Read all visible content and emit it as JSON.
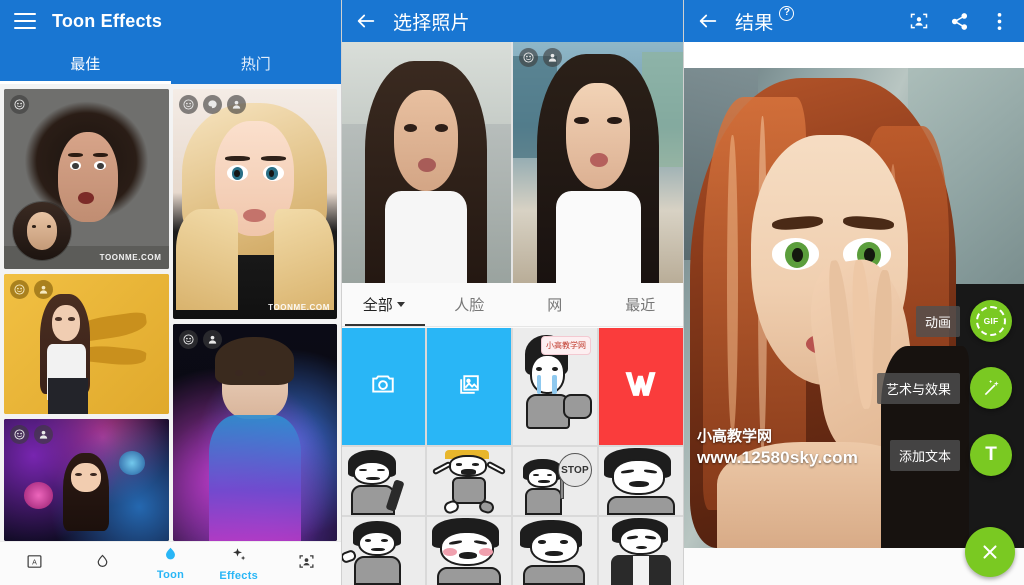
{
  "panel1": {
    "appbar": {
      "menu_icon": "hamburger-icon",
      "title": "Toon Effects"
    },
    "tabs": [
      {
        "label": "最佳",
        "active": true
      },
      {
        "label": "热门",
        "active": false
      }
    ],
    "cards": [
      {
        "id": "card-toonme-3d",
        "watermark": "TOONME.COM",
        "badges": [
          "smiley-icon",
          "person-icon"
        ]
      },
      {
        "id": "card-blonde-toon",
        "watermark": "TOONME.COM",
        "badges": [
          "smiley-icon",
          "paint-icon",
          "person-icon"
        ]
      },
      {
        "id": "card-yellow-portrait",
        "watermark": "",
        "badges": [
          "smiley-icon",
          "person-icon"
        ]
      },
      {
        "id": "card-purple-dress",
        "watermark": "",
        "badges": [
          "smiley-icon",
          "person-icon"
        ]
      },
      {
        "id": "card-neon-floral",
        "watermark": "",
        "badges": [
          "smiley-icon",
          "person-icon"
        ]
      }
    ],
    "bottom_nav": [
      {
        "icon": "frame-icon",
        "label": "",
        "active": false
      },
      {
        "icon": "droplet-outline-icon",
        "label": "",
        "active": false
      },
      {
        "icon": "flame-icon",
        "label": "Toon",
        "active": true
      },
      {
        "icon": "sparkle-icon",
        "label": "Effects",
        "active": true
      },
      {
        "icon": "portrait-icon",
        "label": "",
        "active": false
      }
    ]
  },
  "panel2": {
    "appbar": {
      "back_icon": "arrow-left-icon",
      "title": "选择照片"
    },
    "photos": [
      {
        "id": "photo-selfie-left",
        "badges": []
      },
      {
        "id": "photo-selfie-right",
        "badges": [
          "smiley-icon",
          "person-icon"
        ]
      }
    ],
    "filter_tabs": [
      {
        "label": "全部",
        "has_caret": true,
        "active": true
      },
      {
        "label": "人脸",
        "has_caret": false,
        "active": false
      },
      {
        "label": "网",
        "has_caret": false,
        "active": false
      },
      {
        "label": "最近",
        "has_caret": false,
        "active": false
      }
    ],
    "grid": [
      {
        "id": "tile-camera",
        "kind": "camera",
        "icon": "camera-icon"
      },
      {
        "id": "tile-gallery",
        "kind": "gallery",
        "icon": "gallery-icon"
      },
      {
        "id": "tile-meme-crying",
        "kind": "meme",
        "bubble": "小高教学网"
      },
      {
        "id": "tile-wps",
        "kind": "wps",
        "icon": "wps-logo"
      },
      {
        "id": "tile-meme-guitar",
        "kind": "meme",
        "bubble": ""
      },
      {
        "id": "tile-meme-jump",
        "kind": "meme",
        "bubble": ""
      },
      {
        "id": "tile-meme-stop",
        "kind": "meme",
        "sign": "STOP"
      },
      {
        "id": "tile-meme-laugh",
        "kind": "meme",
        "bubble": ""
      },
      {
        "id": "tile-meme-wave",
        "kind": "meme",
        "bubble": ""
      },
      {
        "id": "tile-meme-blush",
        "kind": "meme",
        "bubble": ""
      },
      {
        "id": "tile-meme-smirk",
        "kind": "meme",
        "bubble": ""
      },
      {
        "id": "tile-meme-suit",
        "kind": "meme",
        "bubble": ""
      }
    ]
  },
  "panel3": {
    "appbar": {
      "back_icon": "arrow-left-icon",
      "title": "结果",
      "help_badge": "?",
      "actions": [
        "portrait-icon",
        "share-icon",
        "overflow-menu-icon"
      ]
    },
    "watermark": {
      "line1": "小高教学网",
      "line2": "www.12580sky.com"
    },
    "fabs": [
      {
        "label": "动画",
        "icon": "gif-icon"
      },
      {
        "label": "艺术与效果",
        "icon": "magic-wand-icon"
      },
      {
        "label": "添加文本",
        "icon": "text-icon",
        "glyph": "T"
      }
    ],
    "close_fab": {
      "icon": "close-icon",
      "glyph": "×"
    }
  },
  "colors": {
    "appbar_blue": "#1976d2",
    "accent_blue": "#29b6f6",
    "fab_green": "#7ac922",
    "wps_red": "#fa3c3c"
  }
}
